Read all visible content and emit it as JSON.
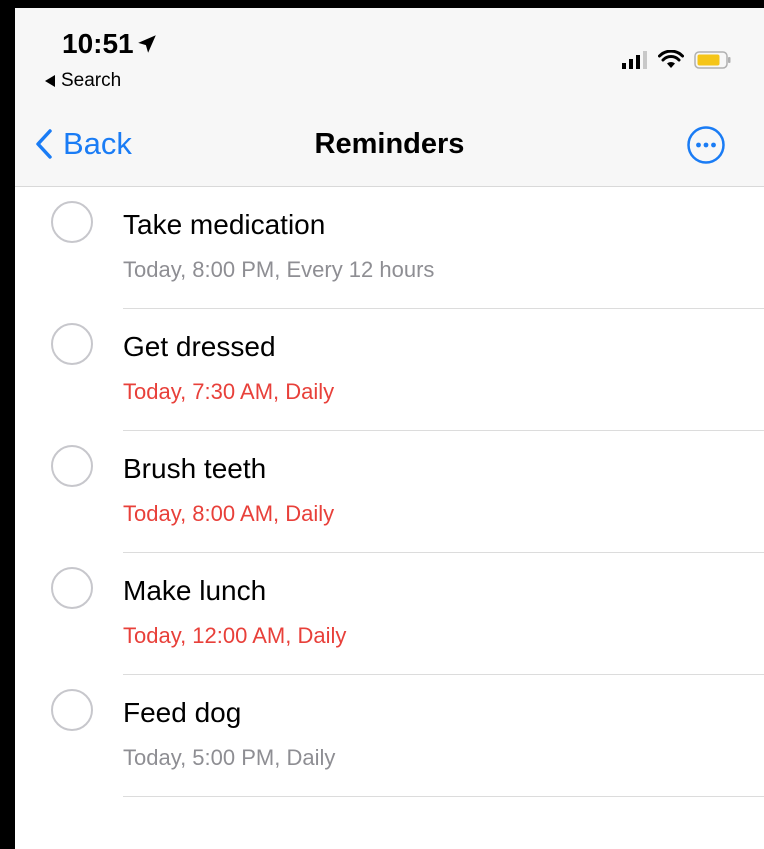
{
  "status_bar": {
    "time": "10:51",
    "back_app": "Search"
  },
  "nav": {
    "back_label": "Back",
    "title": "Reminders"
  },
  "colors": {
    "accent": "#1a7cf5",
    "overdue": "#e8403a",
    "normal_subtitle": "#8e8e93"
  },
  "reminders": [
    {
      "title": "Take medication",
      "subtitle": "Today, 8:00 PM, Every 12 hours",
      "overdue": false
    },
    {
      "title": "Get dressed",
      "subtitle": "Today, 7:30 AM, Daily",
      "overdue": true
    },
    {
      "title": "Brush teeth",
      "subtitle": "Today, 8:00 AM, Daily",
      "overdue": true
    },
    {
      "title": "Make lunch",
      "subtitle": "Today, 12:00 AM, Daily",
      "overdue": true
    },
    {
      "title": "Feed dog",
      "subtitle": "Today, 5:00 PM, Daily",
      "overdue": false
    }
  ]
}
